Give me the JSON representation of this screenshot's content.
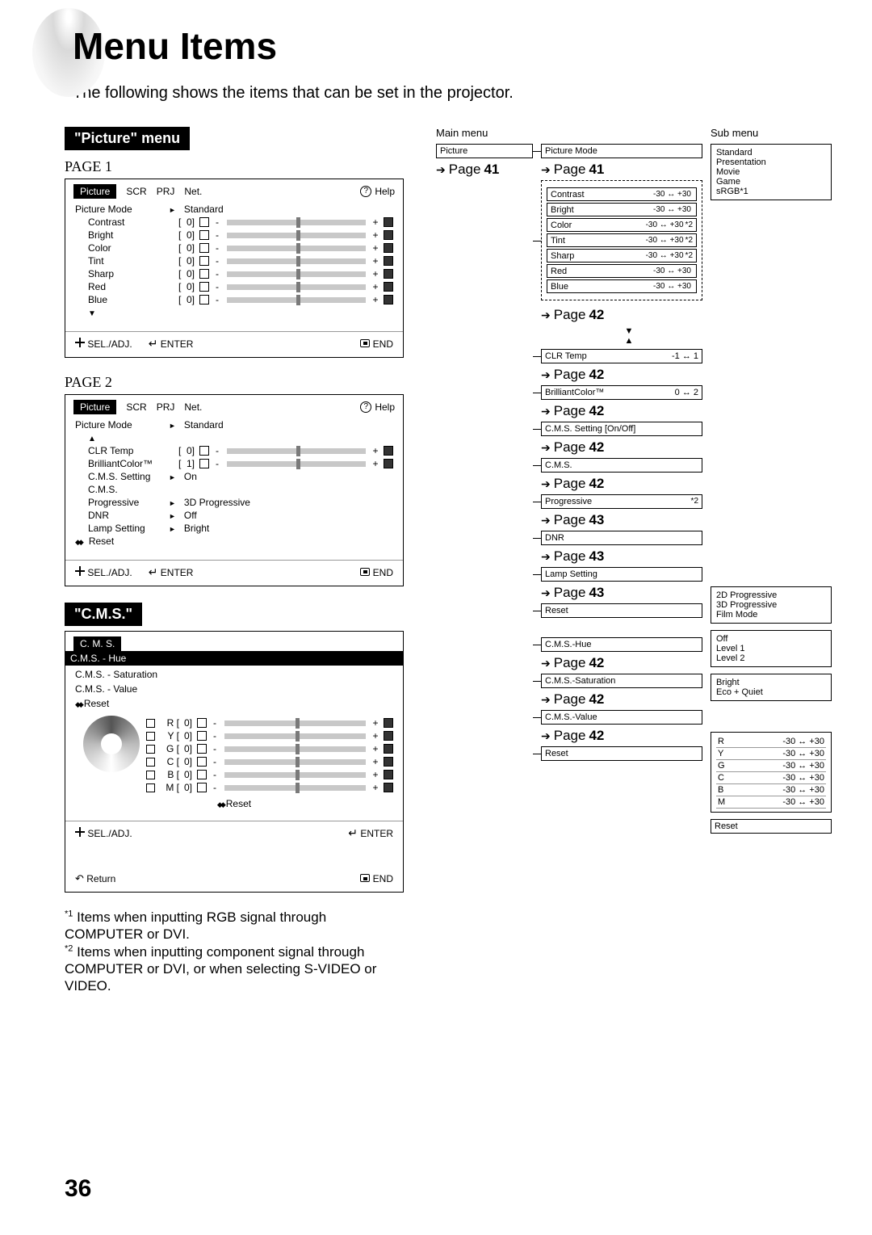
{
  "title": "Menu Items",
  "intro": "The following shows the items that can be set in the projector.",
  "picture_menu_label": "\"Picture\" menu",
  "cms_menu_label": "\"C.M.S.\"",
  "page1_label": "PAGE 1",
  "page2_label": "PAGE 2",
  "osd_tabs": [
    "Picture",
    "SCR",
    "PRJ",
    "Net.",
    "Help"
  ],
  "osd1": {
    "picture_mode_label": "Picture Mode",
    "picture_mode_value": "Standard",
    "rows": [
      {
        "label": "Contrast",
        "value": "0"
      },
      {
        "label": "Bright",
        "value": "0"
      },
      {
        "label": "Color",
        "value": "0"
      },
      {
        "label": "Tint",
        "value": "0"
      },
      {
        "label": "Sharp",
        "value": "0"
      },
      {
        "label": "Red",
        "value": "0"
      },
      {
        "label": "Blue",
        "value": "0"
      }
    ],
    "footer": {
      "sel": "SEL./ADJ.",
      "enter": "ENTER",
      "end": "END"
    }
  },
  "osd2": {
    "picture_mode_label": "Picture Mode",
    "picture_mode_value": "Standard",
    "rows": [
      {
        "label": "CLR Temp",
        "value": "0"
      },
      {
        "label": "BrilliantColor™",
        "value": "1"
      }
    ],
    "cms_setting_label": "C.M.S. Setting",
    "cms_setting_value": "On",
    "cms_label": "C.M.S.",
    "progressive_label": "Progressive",
    "progressive_value": "3D Progressive",
    "dnr_label": "DNR",
    "dnr_value": "Off",
    "lamp_label": "Lamp Setting",
    "lamp_value": "Bright",
    "reset_label": "Reset",
    "footer": {
      "sel": "SEL./ADJ.",
      "enter": "ENTER",
      "end": "END"
    }
  },
  "cms_box": {
    "tab": "C. M. S.",
    "hue": "C.M.S. - Hue",
    "sat": "C.M.S. - Saturation",
    "val": "C.M.S. - Value",
    "reset": "Reset",
    "channels": [
      {
        "label": "R",
        "value": "0"
      },
      {
        "label": "Y",
        "value": "0"
      },
      {
        "label": "G",
        "value": "0"
      },
      {
        "label": "C",
        "value": "0"
      },
      {
        "label": "B",
        "value": "0"
      },
      {
        "label": "M",
        "value": "0"
      }
    ],
    "footer": {
      "sel": "SEL./ADJ.",
      "enter": "ENTER",
      "end": "END",
      "return": "Return"
    }
  },
  "footnote1": "Items when inputting RGB signal through COMPUTER or DVI.",
  "footnote2": "Items when inputting component signal through COMPUTER or DVI, or when selecting S-VIDEO or VIDEO.",
  "page_number": "36",
  "diagram": {
    "main_menu_label": "Main menu",
    "sub_menu_label": "Sub menu",
    "picture": "Picture",
    "picture_mode": "Picture Mode",
    "picture_mode_options": [
      "Standard",
      "Presentation",
      "Movie",
      "Game",
      "sRGB*1"
    ],
    "adjust_rows": [
      {
        "label": "Contrast",
        "range": "-30 ↔ +30",
        "star": ""
      },
      {
        "label": "Bright",
        "range": "-30 ↔ +30",
        "star": ""
      },
      {
        "label": "Color",
        "range": "-30 ↔ +30",
        "star": "*2"
      },
      {
        "label": "Tint",
        "range": "-30 ↔ +30",
        "star": "*2"
      },
      {
        "label": "Sharp",
        "range": "-30 ↔ +30",
        "star": "*2"
      },
      {
        "label": "Red",
        "range": "-30 ↔ +30",
        "star": ""
      },
      {
        "label": "Blue",
        "range": "-30 ↔ +30",
        "star": ""
      }
    ],
    "clr_temp": {
      "label": "CLR Temp",
      "range": "-1 ↔ 1"
    },
    "brilliant": {
      "label": "BrilliantColor™",
      "range": "0 ↔ 2"
    },
    "cms_setting": "C.M.S. Setting [On/Off]",
    "cms_label": "C.M.S.",
    "progressive_label": "Progressive",
    "progressive_star": "*2",
    "progressive_options": [
      "2D Progressive",
      "3D Progressive",
      "Film Mode"
    ],
    "dnr_label": "DNR",
    "dnr_options": [
      "Off",
      "Level 1",
      "Level 2"
    ],
    "lamp_label": "Lamp Setting",
    "lamp_options": [
      "Bright",
      "Eco + Quiet"
    ],
    "reset": "Reset",
    "cms_hue": "C.M.S.-Hue",
    "cms_sat": "C.M.S.-Saturation",
    "cms_val": "C.M.S.-Value",
    "cms_channels": [
      {
        "label": "R",
        "range": "-30 ↔ +30"
      },
      {
        "label": "Y",
        "range": "-30 ↔ +30"
      },
      {
        "label": "G",
        "range": "-30 ↔ +30"
      },
      {
        "label": "C",
        "range": "-30 ↔ +30"
      },
      {
        "label": "B",
        "range": "-30 ↔ +30"
      },
      {
        "label": "M",
        "range": "-30 ↔ +30"
      }
    ],
    "reset2": "Reset",
    "page_links_left": [
      "Page 41"
    ],
    "p41": "Page 41",
    "p42": "Page 42",
    "p43": "Page 43"
  }
}
